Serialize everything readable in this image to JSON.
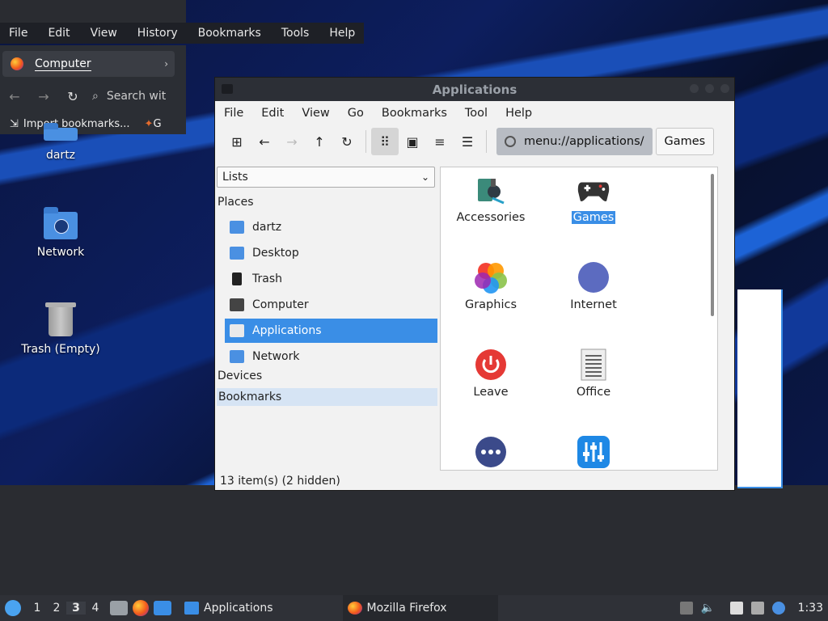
{
  "firefox": {
    "menu": [
      "File",
      "Edit",
      "View",
      "History",
      "Bookmarks",
      "Tools",
      "Help"
    ],
    "tab_title": "Computer",
    "search_placeholder": "Search wit",
    "bookmark_import": "Import bookmarks...",
    "bookmark_next": "G"
  },
  "desktop": {
    "icons": [
      {
        "label": "dartz",
        "icon": "home-folder-icon"
      },
      {
        "label": "Network",
        "icon": "network-folder-icon"
      },
      {
        "label": "Trash (Empty)",
        "icon": "trash-icon"
      }
    ]
  },
  "window": {
    "title": "Applications",
    "menu": [
      "File",
      "Edit",
      "View",
      "Go",
      "Bookmarks",
      "Tool",
      "Help"
    ],
    "location": "menu://applications/",
    "breadcrumb": "Games",
    "side_pane_mode": "Lists",
    "places_heading": "Places",
    "places": [
      "dartz",
      "Desktop",
      "Trash",
      "Computer",
      "Applications",
      "Network"
    ],
    "selected_place": "Applications",
    "devices_heading": "Devices",
    "bookmarks_heading": "Bookmarks",
    "apps": [
      {
        "name": "Accessories",
        "icon": "accessories-icon"
      },
      {
        "name": "Games",
        "icon": "gamepad-icon",
        "selected": true
      },
      {
        "name": "Graphics",
        "icon": "graphics-icon"
      },
      {
        "name": "Internet",
        "icon": "compass-icon"
      },
      {
        "name": "Leave",
        "icon": "power-icon"
      },
      {
        "name": "Office",
        "icon": "document-icon"
      },
      {
        "name": "",
        "icon": "more-icon"
      },
      {
        "name": "",
        "icon": "settings-sliders-icon"
      }
    ],
    "status": "13 item(s) (2 hidden)"
  },
  "taskbar": {
    "workspaces": [
      "1",
      "2",
      "3",
      "4"
    ],
    "current_workspace": "3",
    "tasks": [
      "Applications",
      "Mozilla Firefox"
    ],
    "clock": "1:33"
  }
}
